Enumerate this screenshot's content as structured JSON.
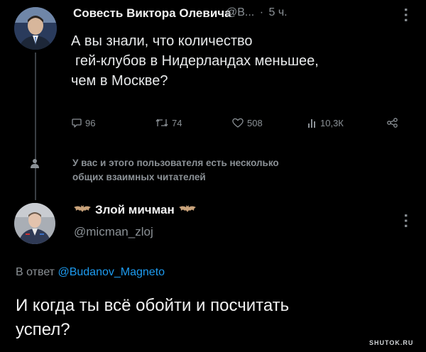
{
  "tweet1": {
    "author_name": "Совесть Виктора Олевича",
    "author_handle": "@В...",
    "separator": "·",
    "time": "5 ч.",
    "text_lines": [
      "А вы знали, что количество",
      "гей-клубов в Нидерландах меньшее,",
      "чем в Москве?"
    ],
    "actions": {
      "replies": "96",
      "retweets": "74",
      "likes": "508",
      "views": "10,3К"
    }
  },
  "mutual_notice": {
    "lines": [
      "У вас и этого пользователя есть несколько",
      "общих взаимных читателей"
    ]
  },
  "tweet2": {
    "author_name": "Злой мичман",
    "author_handle": "@micman_zloj",
    "reply_prefix": "В ответ",
    "reply_to": "@Budanov_Magneto",
    "text_lines": [
      "И когда ты всё обойти и посчитать",
      "успел?"
    ]
  },
  "watermark": "SHUTOK.RU",
  "icons": [
    "reply-icon",
    "retweet-icon",
    "like-icon",
    "views-icon",
    "share-icon",
    "more-icon",
    "person-icon",
    "bat-emoji-icon"
  ],
  "colors": {
    "background": "#000000",
    "text": "#e7e9ea",
    "muted": "#8b9196",
    "link": "#1d9bf0"
  }
}
